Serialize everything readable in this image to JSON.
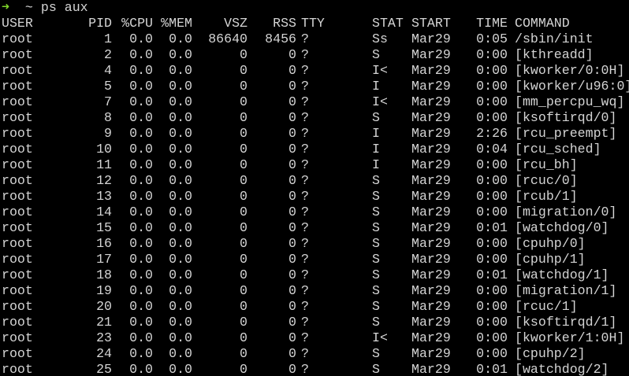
{
  "window": {
    "background": "#000000",
    "foreground": "#d4d4d4",
    "prompt_color": "#7fd62a"
  },
  "prompt": {
    "arrow": "➜",
    "cwd": "~",
    "command": "ps aux"
  },
  "header": {
    "user": "USER",
    "pid": "PID",
    "cpu": "%CPU",
    "mem": "%MEM",
    "vsz": "VSZ",
    "rss": "RSS",
    "tty": "TTY",
    "stat": "STAT",
    "start": "START",
    "time": "TIME",
    "command": "COMMAND"
  },
  "processes": [
    {
      "user": "root",
      "pid": "1",
      "cpu": "0.0",
      "mem": "0.0",
      "vsz": "86640",
      "rss": "8456",
      "tty": "?",
      "stat": "Ss",
      "start": "Mar29",
      "time": "0:05",
      "command": "/sbin/init"
    },
    {
      "user": "root",
      "pid": "2",
      "cpu": "0.0",
      "mem": "0.0",
      "vsz": "0",
      "rss": "0",
      "tty": "?",
      "stat": "S",
      "start": "Mar29",
      "time": "0:00",
      "command": "[kthreadd]"
    },
    {
      "user": "root",
      "pid": "4",
      "cpu": "0.0",
      "mem": "0.0",
      "vsz": "0",
      "rss": "0",
      "tty": "?",
      "stat": "I<",
      "start": "Mar29",
      "time": "0:00",
      "command": "[kworker/0:0H]"
    },
    {
      "user": "root",
      "pid": "5",
      "cpu": "0.0",
      "mem": "0.0",
      "vsz": "0",
      "rss": "0",
      "tty": "?",
      "stat": "I",
      "start": "Mar29",
      "time": "0:00",
      "command": "[kworker/u96:0]"
    },
    {
      "user": "root",
      "pid": "7",
      "cpu": "0.0",
      "mem": "0.0",
      "vsz": "0",
      "rss": "0",
      "tty": "?",
      "stat": "I<",
      "start": "Mar29",
      "time": "0:00",
      "command": "[mm_percpu_wq]"
    },
    {
      "user": "root",
      "pid": "8",
      "cpu": "0.0",
      "mem": "0.0",
      "vsz": "0",
      "rss": "0",
      "tty": "?",
      "stat": "S",
      "start": "Mar29",
      "time": "0:00",
      "command": "[ksoftirqd/0]"
    },
    {
      "user": "root",
      "pid": "9",
      "cpu": "0.0",
      "mem": "0.0",
      "vsz": "0",
      "rss": "0",
      "tty": "?",
      "stat": "I",
      "start": "Mar29",
      "time": "2:26",
      "command": "[rcu_preempt]"
    },
    {
      "user": "root",
      "pid": "10",
      "cpu": "0.0",
      "mem": "0.0",
      "vsz": "0",
      "rss": "0",
      "tty": "?",
      "stat": "I",
      "start": "Mar29",
      "time": "0:04",
      "command": "[rcu_sched]"
    },
    {
      "user": "root",
      "pid": "11",
      "cpu": "0.0",
      "mem": "0.0",
      "vsz": "0",
      "rss": "0",
      "tty": "?",
      "stat": "I",
      "start": "Mar29",
      "time": "0:00",
      "command": "[rcu_bh]"
    },
    {
      "user": "root",
      "pid": "12",
      "cpu": "0.0",
      "mem": "0.0",
      "vsz": "0",
      "rss": "0",
      "tty": "?",
      "stat": "S",
      "start": "Mar29",
      "time": "0:00",
      "command": "[rcuc/0]"
    },
    {
      "user": "root",
      "pid": "13",
      "cpu": "0.0",
      "mem": "0.0",
      "vsz": "0",
      "rss": "0",
      "tty": "?",
      "stat": "S",
      "start": "Mar29",
      "time": "0:00",
      "command": "[rcub/1]"
    },
    {
      "user": "root",
      "pid": "14",
      "cpu": "0.0",
      "mem": "0.0",
      "vsz": "0",
      "rss": "0",
      "tty": "?",
      "stat": "S",
      "start": "Mar29",
      "time": "0:00",
      "command": "[migration/0]"
    },
    {
      "user": "root",
      "pid": "15",
      "cpu": "0.0",
      "mem": "0.0",
      "vsz": "0",
      "rss": "0",
      "tty": "?",
      "stat": "S",
      "start": "Mar29",
      "time": "0:01",
      "command": "[watchdog/0]"
    },
    {
      "user": "root",
      "pid": "16",
      "cpu": "0.0",
      "mem": "0.0",
      "vsz": "0",
      "rss": "0",
      "tty": "?",
      "stat": "S",
      "start": "Mar29",
      "time": "0:00",
      "command": "[cpuhp/0]"
    },
    {
      "user": "root",
      "pid": "17",
      "cpu": "0.0",
      "mem": "0.0",
      "vsz": "0",
      "rss": "0",
      "tty": "?",
      "stat": "S",
      "start": "Mar29",
      "time": "0:00",
      "command": "[cpuhp/1]"
    },
    {
      "user": "root",
      "pid": "18",
      "cpu": "0.0",
      "mem": "0.0",
      "vsz": "0",
      "rss": "0",
      "tty": "?",
      "stat": "S",
      "start": "Mar29",
      "time": "0:01",
      "command": "[watchdog/1]"
    },
    {
      "user": "root",
      "pid": "19",
      "cpu": "0.0",
      "mem": "0.0",
      "vsz": "0",
      "rss": "0",
      "tty": "?",
      "stat": "S",
      "start": "Mar29",
      "time": "0:00",
      "command": "[migration/1]"
    },
    {
      "user": "root",
      "pid": "20",
      "cpu": "0.0",
      "mem": "0.0",
      "vsz": "0",
      "rss": "0",
      "tty": "?",
      "stat": "S",
      "start": "Mar29",
      "time": "0:00",
      "command": "[rcuc/1]"
    },
    {
      "user": "root",
      "pid": "21",
      "cpu": "0.0",
      "mem": "0.0",
      "vsz": "0",
      "rss": "0",
      "tty": "?",
      "stat": "S",
      "start": "Mar29",
      "time": "0:00",
      "command": "[ksoftirqd/1]"
    },
    {
      "user": "root",
      "pid": "23",
      "cpu": "0.0",
      "mem": "0.0",
      "vsz": "0",
      "rss": "0",
      "tty": "?",
      "stat": "I<",
      "start": "Mar29",
      "time": "0:00",
      "command": "[kworker/1:0H]"
    },
    {
      "user": "root",
      "pid": "24",
      "cpu": "0.0",
      "mem": "0.0",
      "vsz": "0",
      "rss": "0",
      "tty": "?",
      "stat": "S",
      "start": "Mar29",
      "time": "0:00",
      "command": "[cpuhp/2]"
    },
    {
      "user": "root",
      "pid": "25",
      "cpu": "0.0",
      "mem": "0.0",
      "vsz": "0",
      "rss": "0",
      "tty": "?",
      "stat": "S",
      "start": "Mar29",
      "time": "0:01",
      "command": "[watchdog/2]"
    }
  ]
}
